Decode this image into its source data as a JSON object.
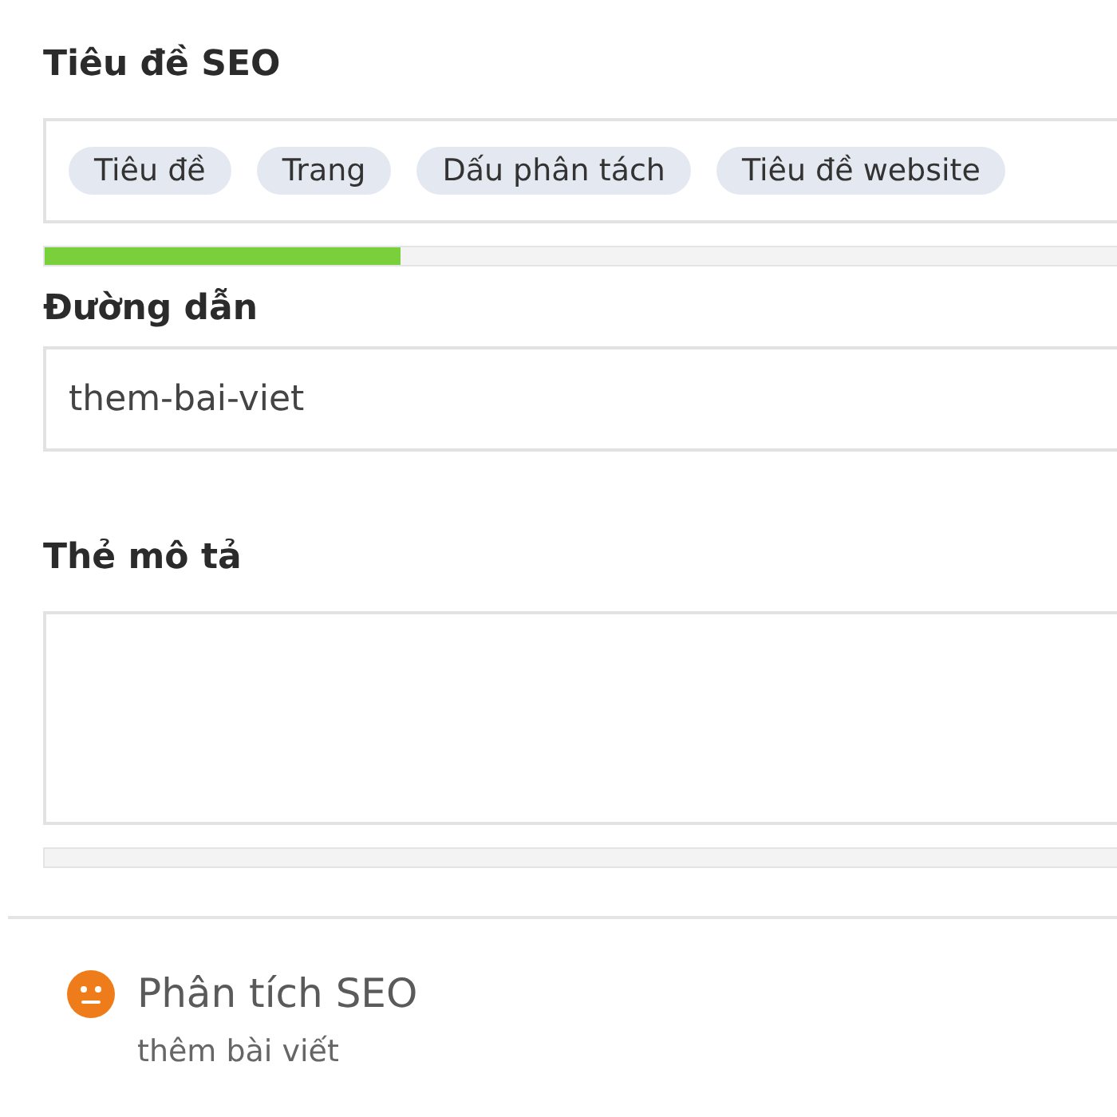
{
  "seo_title": {
    "label": "Tiêu đề SEO",
    "tags": [
      "Tiêu đề",
      "Trang",
      "Dấu phân tách",
      "Tiêu đề website"
    ],
    "level": 0.31
  },
  "slug": {
    "label": "Đường dẫn",
    "value": "them-bai-viet"
  },
  "meta_description": {
    "label": "Thẻ mô tả",
    "level": 0
  },
  "seo_analysis": {
    "color": "#ee7c1b",
    "title": "Phân tích SEO",
    "keyword": "thêm bài viết"
  }
}
